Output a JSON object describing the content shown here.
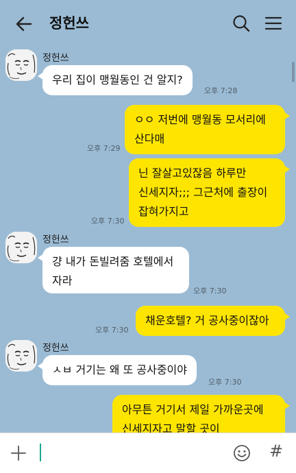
{
  "header": {
    "title": "정헌쓰"
  },
  "messages": [
    {
      "sender": "정헌쓰",
      "lines": [
        "우리 집이 맹월동인 건 알지?"
      ],
      "time": "오후 7:28"
    },
    {
      "lines": [
        "ㅇㅇ 저번에 맹월동 모서리에",
        "산다매"
      ],
      "time": "오후 7:29"
    },
    {
      "lines": [
        "닌 잘살고있잖음 하루만",
        "신세지자;;; 그근처에 출장이",
        "잡혀가지고"
      ],
      "time": "오후 7:30"
    },
    {
      "sender": "정헌쓰",
      "lines": [
        "걍 내가 돈빌려줌 호텔에서",
        "자라"
      ],
      "time": "오후 7:30"
    },
    {
      "lines": [
        "채운호텔? 거 공사중이잖아"
      ],
      "time": "오후 7:30"
    },
    {
      "sender": "정헌쓰",
      "lines": [
        "ㅅㅂ 거기는 왜 또 공사중이야"
      ],
      "time": "오후 7:30"
    },
    {
      "lines": [
        "아무튼 거기서 제일 가까운곳에",
        "신세지자고 말할 곳이"
      ]
    }
  ],
  "icons": {
    "back": "arrow-left-icon",
    "search": "search-icon",
    "menu": "hamburger-menu-icon",
    "plus": "plus-icon",
    "emoji": "emoji-icon",
    "hash": "#"
  },
  "colors": {
    "background": "#9bbbd4",
    "incoming_bubble": "#ffffff",
    "outgoing_bubble": "#fee500",
    "caret": "#1aa78f"
  }
}
